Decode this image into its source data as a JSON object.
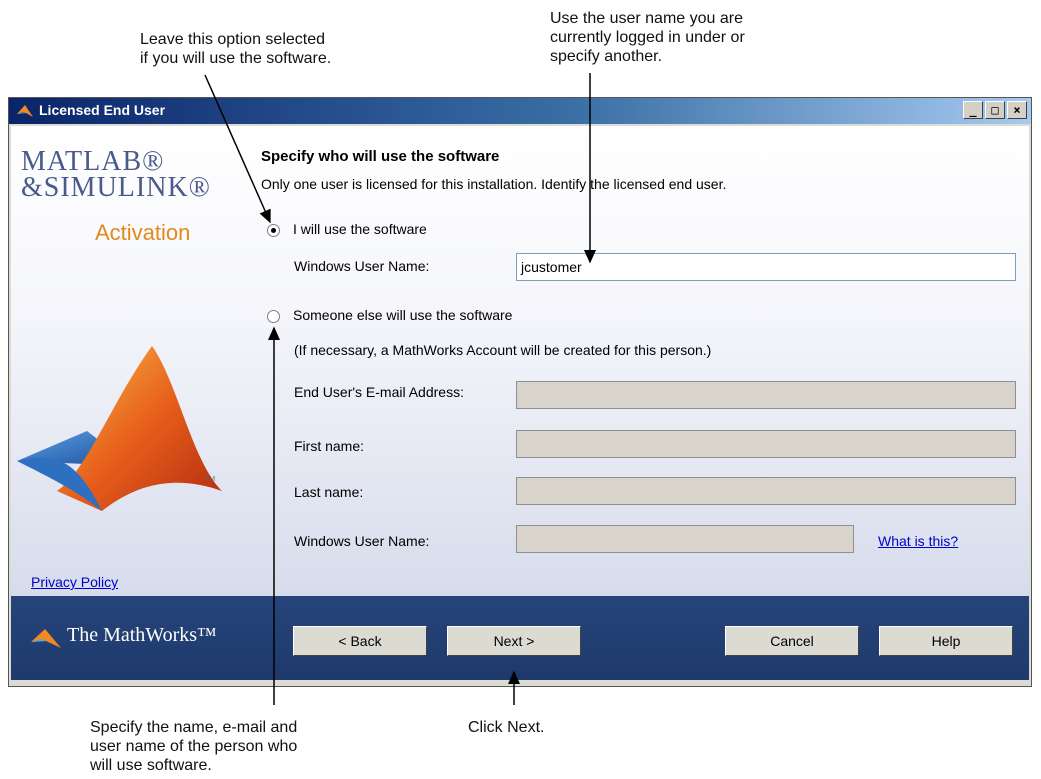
{
  "callouts": {
    "top_left": "Leave this option selected\n if you will use the software.",
    "top_right": "Use the user name you are\ncurrently logged in under or\nspecify another.",
    "bottom_left": "Specify the name, e-mail and\nuser name of the person who\nwill use software.",
    "bottom_center": "Click Next."
  },
  "window": {
    "title": "Licensed End User",
    "controls": [
      "_",
      "□",
      "×"
    ]
  },
  "branding": {
    "matlab": "MATLAB®",
    "simulink": "&SIMULINK®",
    "activation": "Activation",
    "privacy_link": "Privacy Policy",
    "mathworks": "The MathWorks™"
  },
  "form": {
    "heading": "Specify who will use the software",
    "subheading": "Only one user is licensed for this installation. Identify the licensed end user.",
    "option_self": "I will use the software",
    "windows_user_label": "Windows User Name:",
    "windows_user_value": "jcustomer",
    "option_other": "Someone else will use the software",
    "other_note": "(If necessary, a MathWorks Account will be created for this person.)",
    "email_label": "End User's E-mail Address:",
    "first_name_label": "First name:",
    "last_name_label": "Last name:",
    "other_windows_user_label": "Windows User Name:",
    "what_is_this": "What is this?"
  },
  "buttons": {
    "back": "< Back",
    "next": "Next >",
    "cancel": "Cancel",
    "help": "Help"
  },
  "colors": {
    "title_bar": "#0a246a",
    "footer": "#26447a",
    "activation": "#e08a1e",
    "link": "#0000cc"
  }
}
